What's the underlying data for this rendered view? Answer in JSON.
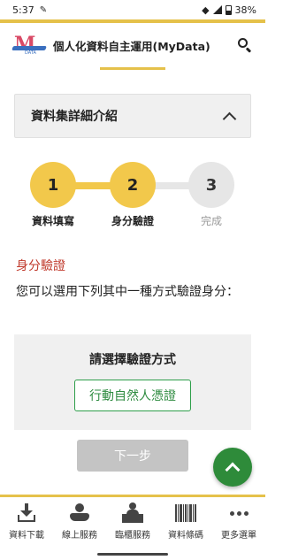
{
  "status_bar": {
    "time": "5:37",
    "battery": "38%"
  },
  "header": {
    "title": "個人化資料自主運用(MyData)",
    "logo_text": "M",
    "logo_tag": "DATA"
  },
  "accordion": {
    "title": "資料集詳細介紹"
  },
  "stepper": {
    "steps": [
      {
        "number": "1",
        "label": "資料填寫",
        "state": "done"
      },
      {
        "number": "2",
        "label": "身分驗證",
        "state": "current"
      },
      {
        "number": "3",
        "label": "完成",
        "state": "pending"
      }
    ]
  },
  "section": {
    "heading": "身分驗證",
    "description": "您可以選用下列其中一種方式驗證身分："
  },
  "verification": {
    "title": "請選擇驗證方式",
    "options": [
      "行動自然人憑證"
    ]
  },
  "next_button": {
    "label": "下一步",
    "enabled": false
  },
  "bottom_nav": {
    "items": [
      {
        "label": "資料下載",
        "icon": "download-icon"
      },
      {
        "label": "線上服務",
        "icon": "hand-service-icon"
      },
      {
        "label": "臨櫃服務",
        "icon": "counter-service-icon"
      },
      {
        "label": "資料條碼",
        "icon": "barcode-icon"
      },
      {
        "label": "更多選單",
        "icon": "more-icon"
      }
    ]
  },
  "colors": {
    "accent_gold": "#f2c84b",
    "alert_red": "#c0392b",
    "green": "#2e8b3a",
    "disabled_gray": "#c4c4c4"
  }
}
